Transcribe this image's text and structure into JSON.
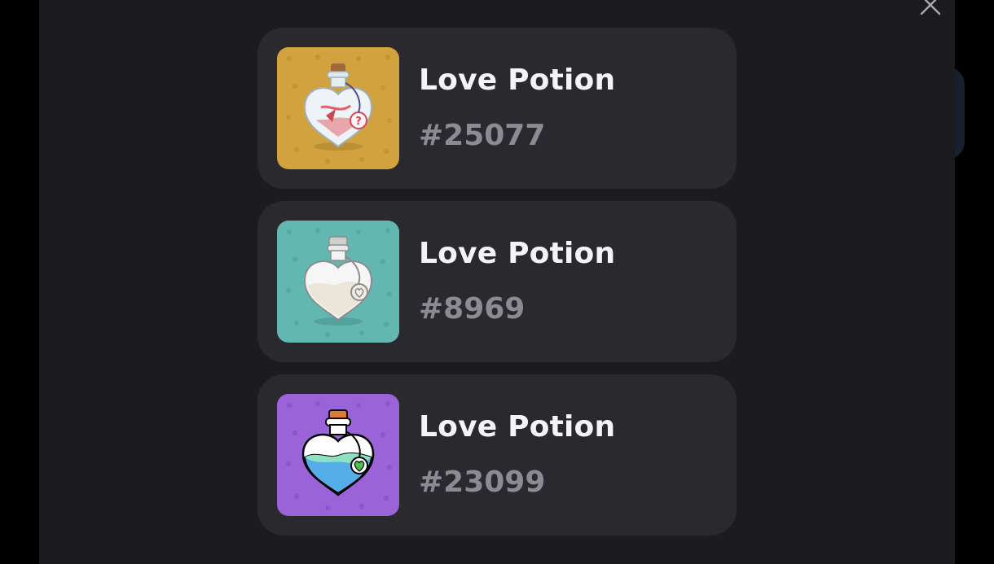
{
  "modal": {
    "close_icon": "close-icon",
    "items": [
      {
        "name": "Love Potion",
        "id": "#25077",
        "image_icon": "potion-bottle-mystery",
        "background": "#d1a23e",
        "liquid": "#e9c6c9"
      },
      {
        "name": "Love Potion",
        "id": "#8969",
        "image_icon": "potion-bottle-white",
        "background": "#63b7b1",
        "liquid": "#f1ece2"
      },
      {
        "name": "Love Potion",
        "id": "#23099",
        "image_icon": "potion-bottle-blue",
        "background": "#9a63d8",
        "liquid": "#56aee9"
      }
    ]
  },
  "colors": {
    "page_background": "#000000",
    "modal_background": "#1c1c1e",
    "card_background": "#2a292e",
    "title_text": "#f4f4f6",
    "id_text": "#8c8b93"
  }
}
